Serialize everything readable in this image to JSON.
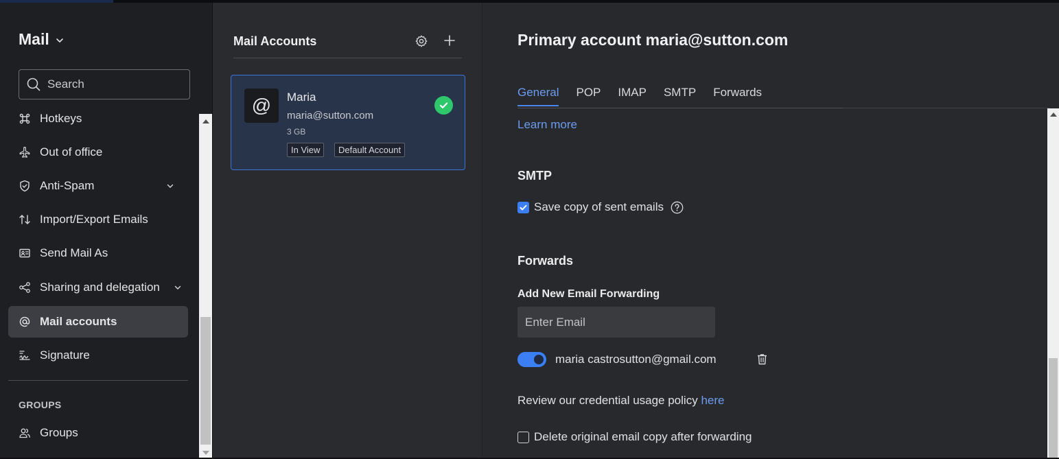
{
  "sidebar": {
    "app_title": "Mail",
    "search_placeholder": "Search",
    "items": [
      {
        "label": "Hotkeys"
      },
      {
        "label": "Out of office"
      },
      {
        "label": "Anti-Spam"
      },
      {
        "label": "Import/Export Emails"
      },
      {
        "label": "Send Mail As"
      },
      {
        "label": "Sharing and delegation"
      },
      {
        "label": "Mail accounts"
      },
      {
        "label": "Signature"
      }
    ],
    "groups_heading": "GROUPS",
    "groups_item": "Groups"
  },
  "middle": {
    "title": "Mail Accounts",
    "account": {
      "avatar_glyph": "@",
      "name": "Maria",
      "email": "maria@sutton.com",
      "storage": "3 GB",
      "badges": [
        "In View",
        "Default Account"
      ]
    }
  },
  "detail": {
    "title": "Primary account maria@sutton.com",
    "tabs": [
      "General",
      "POP",
      "IMAP",
      "SMTP",
      "Forwards"
    ],
    "active_tab": "General",
    "learn_more": "Learn more",
    "smtp": {
      "heading": "SMTP",
      "save_copy_label": "Save copy of sent emails",
      "save_copy_checked": true
    },
    "forwards": {
      "heading": "Forwards",
      "add_heading": "Add New Email Forwarding",
      "email_placeholder": "Enter Email",
      "forward_address": "maria castrosutton@gmail.com",
      "forward_enabled": true,
      "policy_text": "Review our credential usage policy",
      "policy_link": "here",
      "delete_original_label": "Delete original email copy after forwarding",
      "delete_original_checked": false
    }
  },
  "colors": {
    "accent": "#3b7ff2",
    "link": "#6a9cf0",
    "success": "#2fc76b",
    "sidebar_bg": "#1e1f22",
    "panel_bg": "#28292c"
  },
  "icons": {
    "app_title": "chevron-down-icon",
    "search": "search-icon",
    "hotkeys": "command-icon",
    "out_of_office": "plane-icon",
    "anti_spam": "shield-check-icon",
    "import_export": "arrows-up-down-icon",
    "send_mail_as": "id-card-icon",
    "sharing": "share-icon",
    "mail_accounts": "at-icon",
    "signature": "signature-icon",
    "groups": "users-icon",
    "settings": "gear-icon",
    "add": "plus-icon",
    "default_check": "check-circle-icon",
    "help": "help-icon",
    "delete": "trash-icon"
  }
}
